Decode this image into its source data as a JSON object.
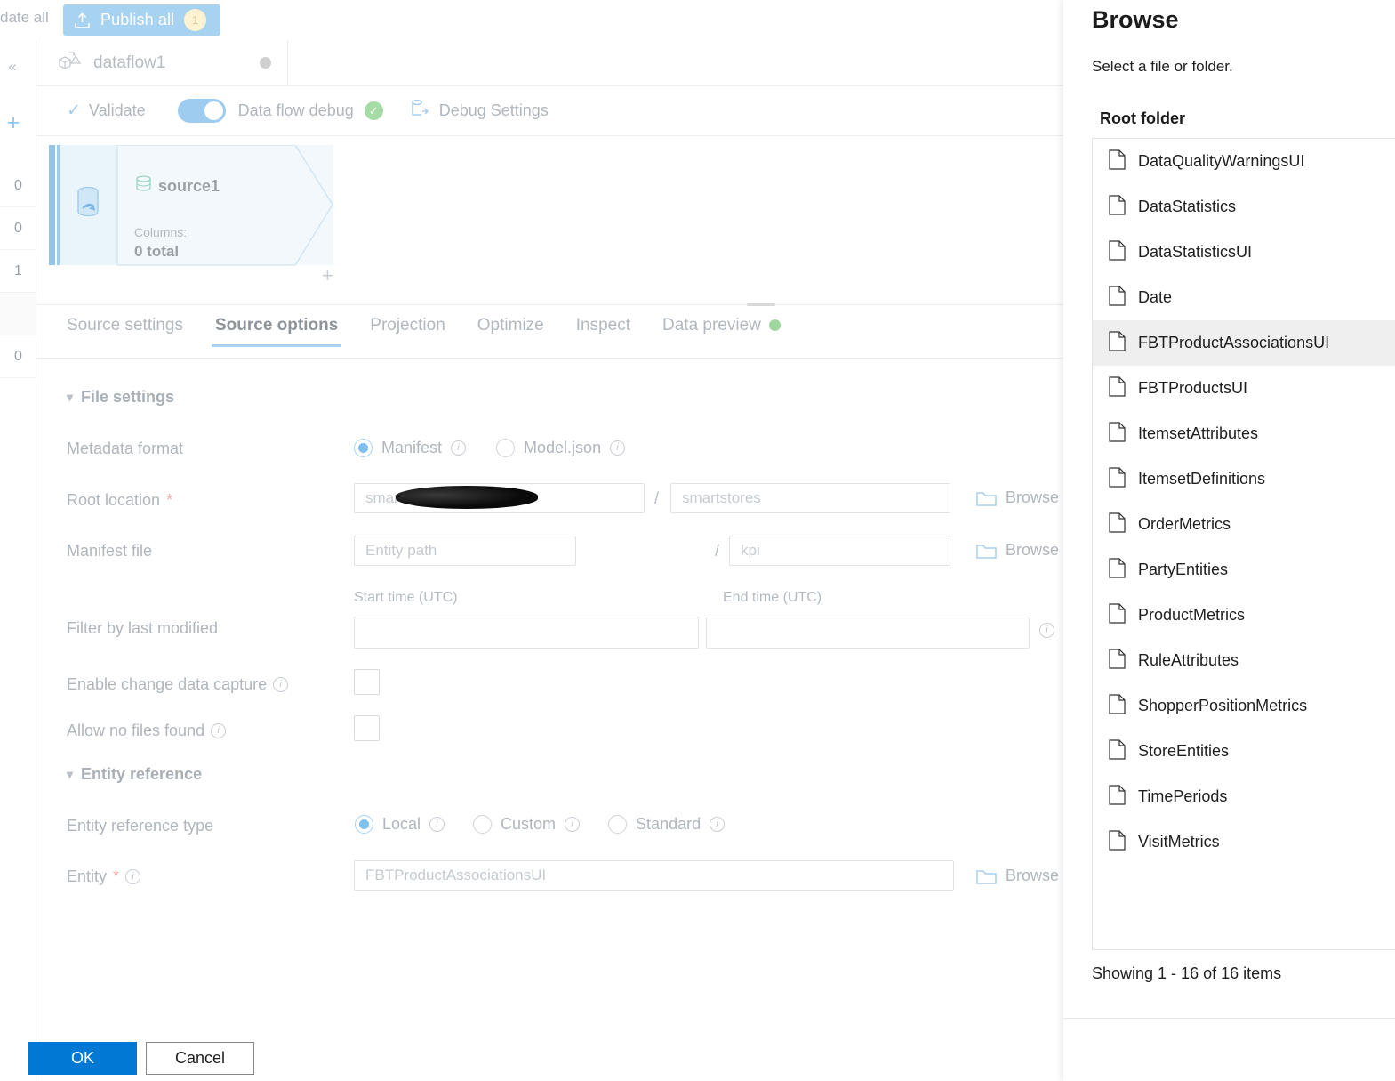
{
  "toolbar": {
    "update_all_label": "date all",
    "publish_all_label": "Publish all",
    "publish_badge": "1",
    "publish_icon": "upload-icon"
  },
  "left_rail": {
    "collapse_icon": "chevron-double-left-icon",
    "add_icon": "plus-icon",
    "counts": [
      "0",
      "0",
      "1",
      "0"
    ]
  },
  "dataflow_tab": {
    "icon": "dataflow-icon",
    "name": "dataflow1",
    "status_dot": "inactive-dot"
  },
  "debug_toolbar": {
    "validate_label": "Validate",
    "validate_icon": "check-icon",
    "debug_toggle_label": "Data flow debug",
    "debug_toggle_state": "on",
    "debug_status_icon": "green-check-icon",
    "debug_settings_label": "Debug Settings",
    "debug_settings_icon": "debug-settings-icon"
  },
  "canvas": {
    "node": {
      "icon": "database-source-icon",
      "title": "source1",
      "columns_label": "Columns:",
      "columns_value": "0 total",
      "add_icon": "plus-icon"
    }
  },
  "tabs": [
    {
      "label": "Source settings",
      "active": false
    },
    {
      "label": "Source options",
      "active": true
    },
    {
      "label": "Projection",
      "active": false
    },
    {
      "label": "Optimize",
      "active": false
    },
    {
      "label": "Inspect",
      "active": false
    },
    {
      "label": "Data preview",
      "active": false,
      "dot": "green-status-dot"
    }
  ],
  "form": {
    "file_settings_section": "File settings",
    "metadata_format_label": "Metadata format",
    "metadata_options": [
      {
        "label": "Manifest",
        "selected": true
      },
      {
        "label": "Model.json",
        "selected": false
      }
    ],
    "root_location_label": "Root location",
    "root_location_required": "*",
    "root_location_value": "smar",
    "root_location_container_value": "smartstores",
    "manifest_file_label": "Manifest file",
    "manifest_entity_path_placeholder": "Entity path",
    "manifest_file_value": "kpi",
    "path_separator": "/",
    "browse_label": "Browse",
    "browse_icon": "folder-icon",
    "start_time_label": "Start time (UTC)",
    "end_time_label": "End time (UTC)",
    "filter_by_last_modified_label": "Filter by last modified",
    "start_time_value": "",
    "end_time_value": "",
    "enable_cdc_label": "Enable change data capture",
    "enable_cdc_checked": false,
    "allow_no_files_label": "Allow no files found",
    "allow_no_files_checked": false,
    "entity_reference_section": "Entity reference",
    "entity_reference_type_label": "Entity reference type",
    "entity_reference_options": [
      {
        "label": "Local",
        "selected": true
      },
      {
        "label": "Custom",
        "selected": false
      },
      {
        "label": "Standard",
        "selected": false
      }
    ],
    "entity_label": "Entity",
    "entity_required": "*",
    "entity_value": "FBTProductAssociationsUI"
  },
  "browse_panel": {
    "title": "Browse",
    "subtitle": "Select a file or folder.",
    "list_label": "Root folder",
    "items": [
      {
        "name": "DataQualityWarningsUI",
        "selected": false
      },
      {
        "name": "DataStatistics",
        "selected": false
      },
      {
        "name": "DataStatisticsUI",
        "selected": false
      },
      {
        "name": "Date",
        "selected": false
      },
      {
        "name": "FBTProductAssociationsUI",
        "selected": true
      },
      {
        "name": "FBTProductsUI",
        "selected": false
      },
      {
        "name": "ItemsetAttributes",
        "selected": false
      },
      {
        "name": "ItemsetDefinitions",
        "selected": false
      },
      {
        "name": "OrderMetrics",
        "selected": false
      },
      {
        "name": "PartyEntities",
        "selected": false
      },
      {
        "name": "ProductMetrics",
        "selected": false
      },
      {
        "name": "RuleAttributes",
        "selected": false
      },
      {
        "name": "ShopperPositionMetrics",
        "selected": false
      },
      {
        "name": "StoreEntities",
        "selected": false
      },
      {
        "name": "TimePeriods",
        "selected": false
      },
      {
        "name": "VisitMetrics",
        "selected": false
      }
    ],
    "showing_text": "Showing 1 - 16 of 16 items",
    "ok_label": "OK",
    "cancel_label": "Cancel",
    "accent_color": "#0078d4",
    "selected_row_color": "#efefef"
  }
}
